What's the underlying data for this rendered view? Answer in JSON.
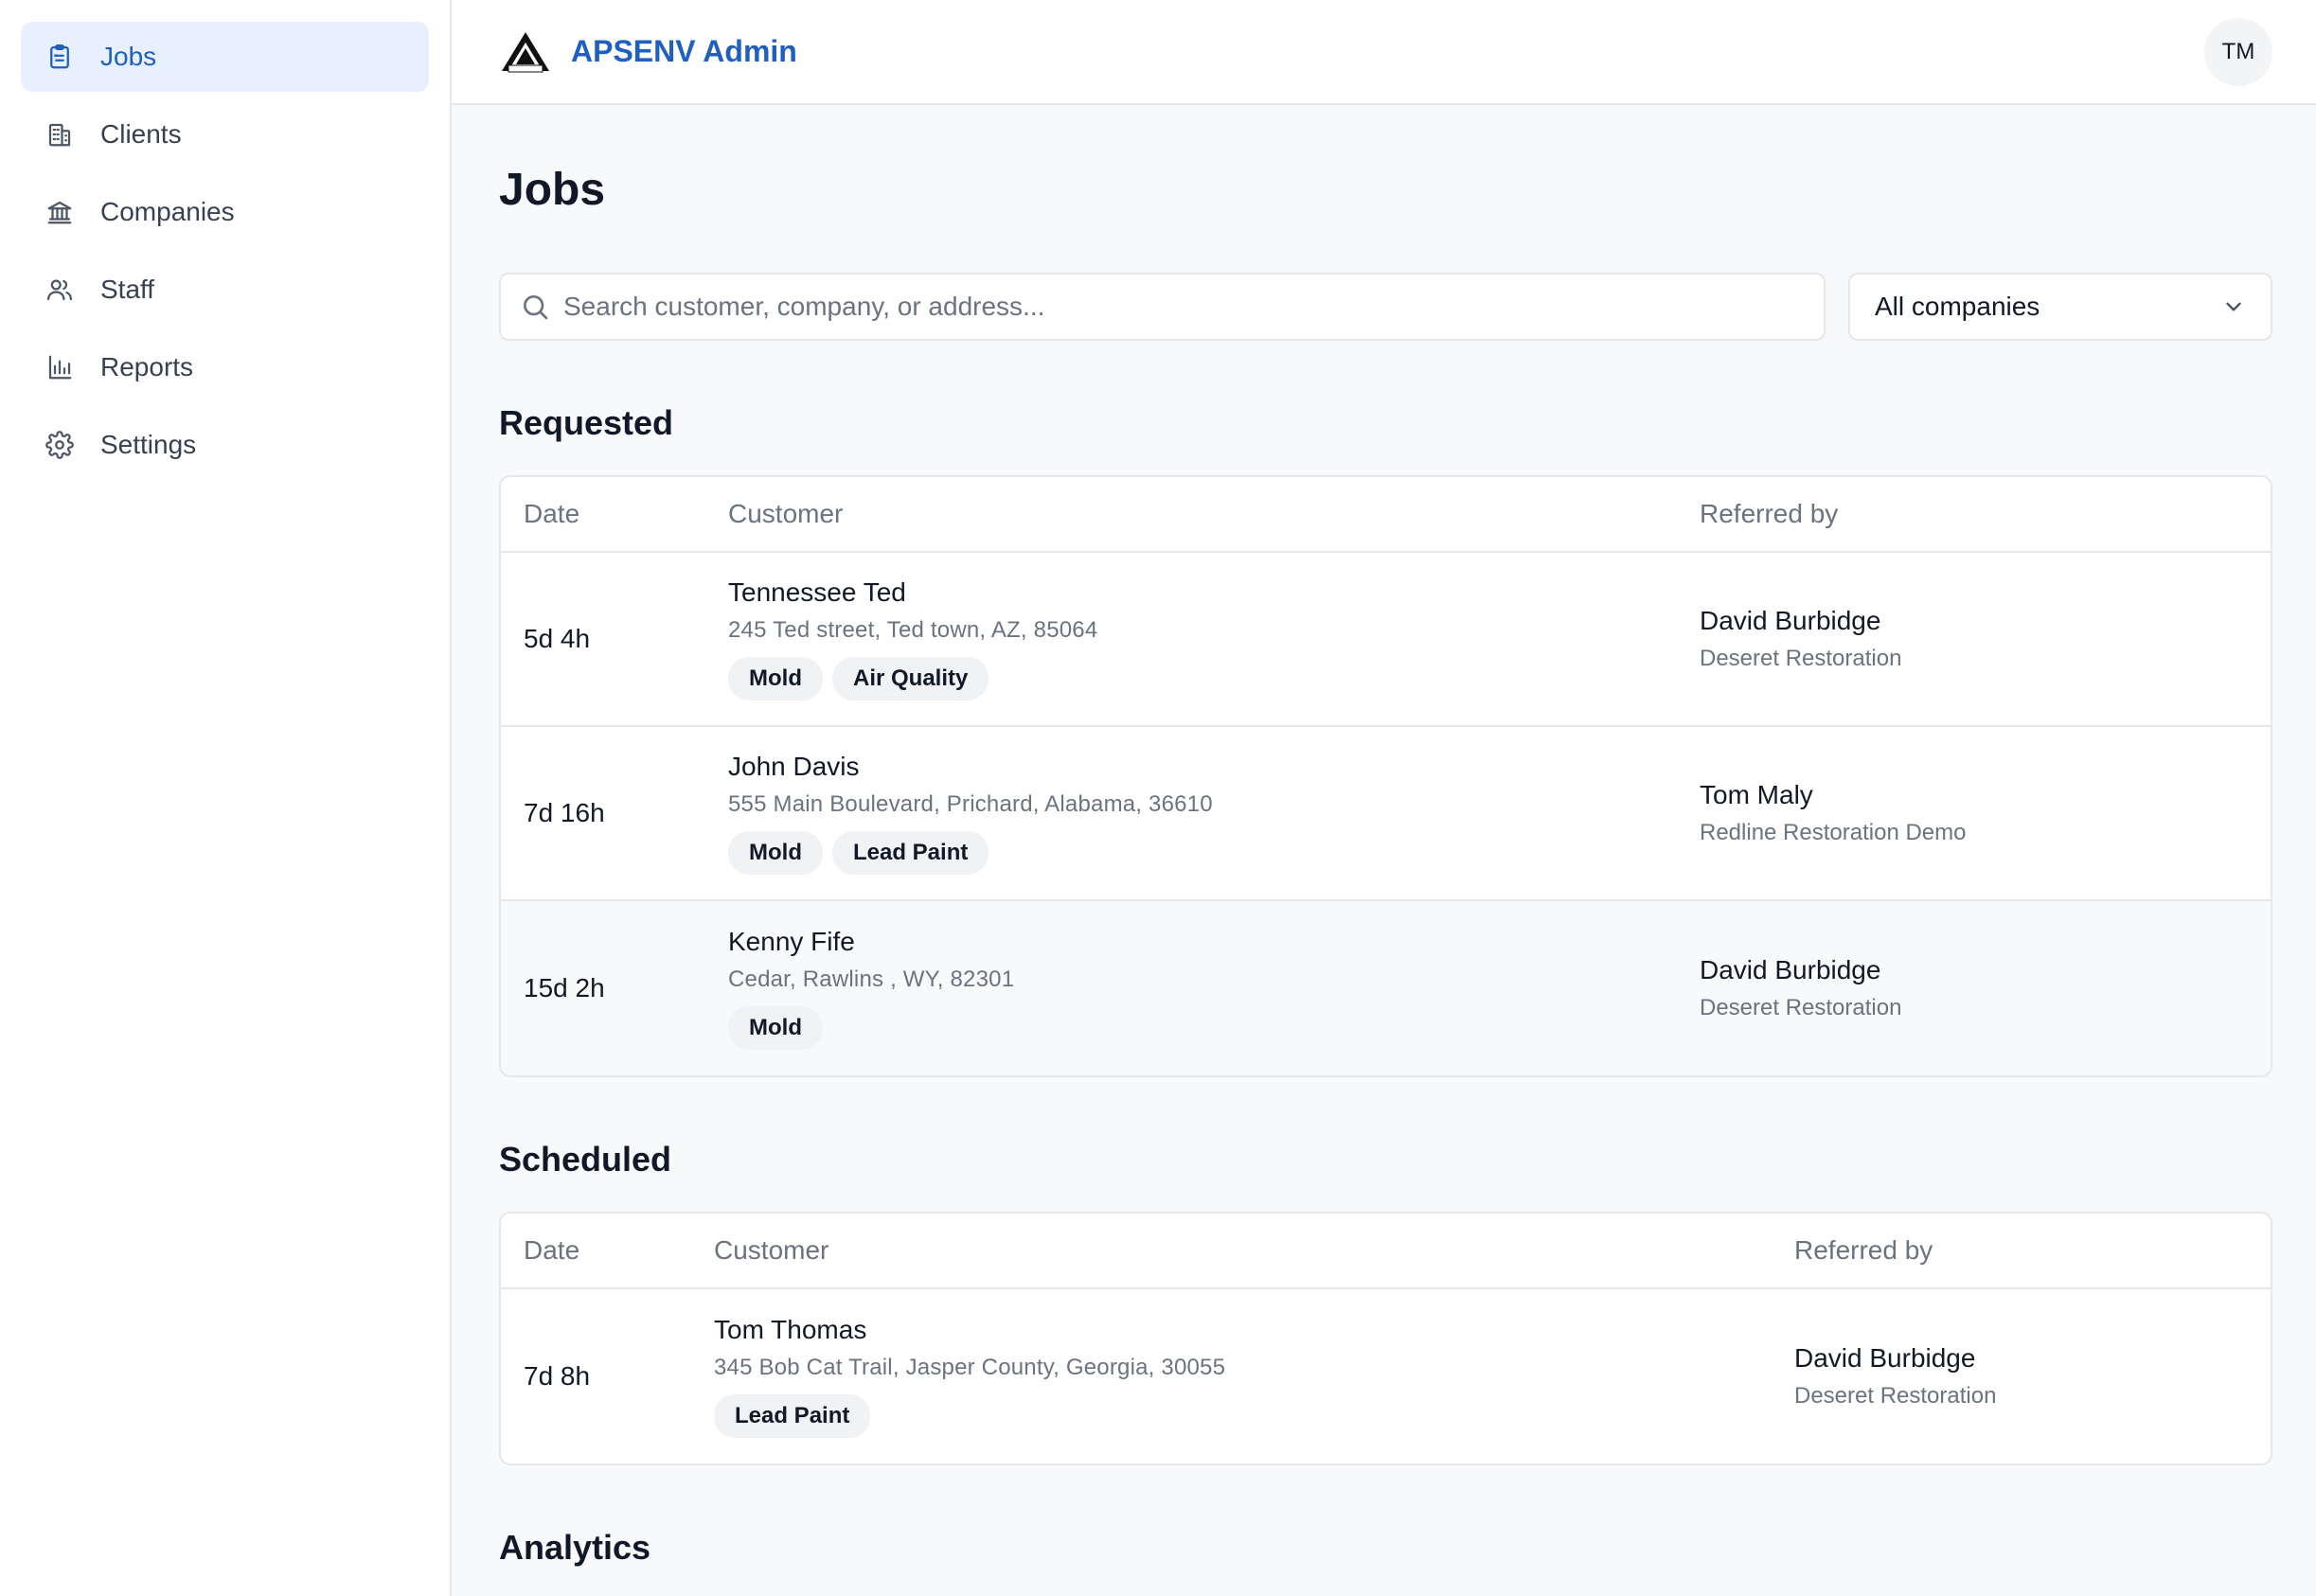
{
  "sidebar": {
    "items": [
      {
        "label": "Jobs",
        "icon": "clipboard-icon",
        "active": true
      },
      {
        "label": "Clients",
        "icon": "building-icon"
      },
      {
        "label": "Companies",
        "icon": "bank-icon"
      },
      {
        "label": "Staff",
        "icon": "users-icon"
      },
      {
        "label": "Reports",
        "icon": "bar-chart-icon"
      },
      {
        "label": "Settings",
        "icon": "gear-icon"
      }
    ]
  },
  "header": {
    "brand_title": "APSENV Admin",
    "logo": "aps-logo",
    "avatar_initials": "TM"
  },
  "page": {
    "title": "Jobs",
    "search_placeholder": "Search customer, company, or address...",
    "company_filter": "All companies"
  },
  "requested": {
    "title": "Requested",
    "columns": {
      "date": "Date",
      "customer": "Customer",
      "referred_by": "Referred by"
    },
    "rows": [
      {
        "date": "5d 4h",
        "name": "Tennessee Ted",
        "address": "245 Ted street, Ted town, AZ, 85064",
        "tags": [
          "Mold",
          "Air Quality"
        ],
        "ref_name": "David Burbidge",
        "ref_company": "Deseret Restoration"
      },
      {
        "date": "7d 16h",
        "name": "John Davis",
        "address": "555 Main Boulevard, Prichard, Alabama, 36610",
        "tags": [
          "Mold",
          "Lead Paint"
        ],
        "ref_name": "Tom Maly",
        "ref_company": "Redline Restoration Demo"
      },
      {
        "date": "15d 2h",
        "name": "Kenny Fife",
        "address": "Cedar, Rawlins , WY, 82301",
        "tags": [
          "Mold"
        ],
        "ref_name": "David Burbidge",
        "ref_company": "Deseret Restoration"
      }
    ]
  },
  "scheduled": {
    "title": "Scheduled",
    "columns": {
      "date": "Date",
      "customer": "Customer",
      "referred_by": "Referred by"
    },
    "rows": [
      {
        "date": "7d 8h",
        "name": "Tom Thomas",
        "address": "345 Bob Cat Trail, Jasper County, Georgia, 30055",
        "tags": [
          "Lead Paint"
        ],
        "ref_name": "David Burbidge",
        "ref_company": "Deseret Restoration"
      }
    ]
  },
  "analytics": {
    "title": "Analytics"
  },
  "colors": {
    "accent": "#1f5fbf",
    "active_bg": "#e8f0fd",
    "page_bg": "#f8f9fb",
    "border": "#e5e7eb",
    "muted_text": "#6b7280"
  }
}
